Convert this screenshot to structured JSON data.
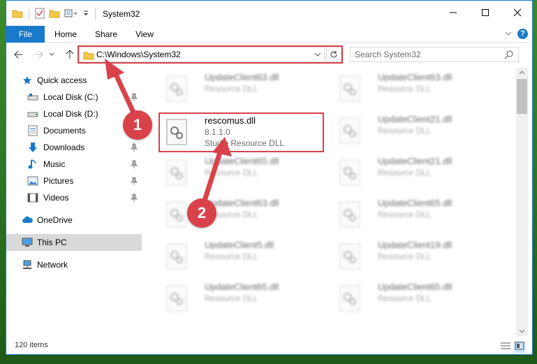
{
  "window": {
    "title": "System32"
  },
  "ribbon": {
    "tabs": [
      "File",
      "Home",
      "Share",
      "View"
    ]
  },
  "address": {
    "path": "C:\\Windows\\System32"
  },
  "search": {
    "placeholder": "Search System32"
  },
  "sidebar": {
    "items": [
      {
        "label": "Quick access",
        "icon": "star-icon"
      },
      {
        "label": "Local Disk (C:)",
        "icon": "drive-icon"
      },
      {
        "label": "Local Disk (D:)",
        "icon": "drive-icon"
      },
      {
        "label": "Documents",
        "icon": "documents-icon"
      },
      {
        "label": "Downloads",
        "icon": "downloads-icon"
      },
      {
        "label": "Music",
        "icon": "music-icon"
      },
      {
        "label": "Pictures",
        "icon": "pictures-icon"
      },
      {
        "label": "Videos",
        "icon": "videos-icon"
      },
      {
        "label": "OneDrive",
        "icon": "cloud-icon"
      },
      {
        "label": "This PC",
        "icon": "computer-icon"
      },
      {
        "label": "Network",
        "icon": "network-icon"
      }
    ]
  },
  "files": {
    "highlighted": {
      "name": "rescomus.dll",
      "version": "8.1.1.0",
      "description": "Studio Resource DLL"
    },
    "blurred": [
      {
        "name": "UpdateClient63.dll",
        "description": "Resource DLL"
      },
      {
        "name": "UpdateClient63.dll",
        "description": "Resource DLL"
      },
      {
        "name": "UpdateClient21.dll",
        "description": "Resource DLL"
      },
      {
        "name": "UpdateClient65.dll",
        "description": "Resource DLL"
      },
      {
        "name": "UpdateClient21.dll",
        "description": "Resource DLL"
      },
      {
        "name": "UpdateClient63.dll",
        "description": "Resource DLL"
      },
      {
        "name": "UpdateClient65.dll",
        "description": "Resource DLL"
      },
      {
        "name": "UpdateClient5.dll",
        "description": "Resource DLL"
      },
      {
        "name": "UpdateClient19.dll",
        "description": "Resource DLL"
      },
      {
        "name": "UpdateClient65.dll",
        "description": "Resource DLL"
      },
      {
        "name": "UpdateClient65.dll",
        "description": "Resource DLL"
      }
    ]
  },
  "status": {
    "item_count": "120 items"
  },
  "annotations": {
    "step1": "1",
    "step2": "2"
  },
  "colors": {
    "accent": "#1979ca",
    "highlight": "#d9414b"
  }
}
